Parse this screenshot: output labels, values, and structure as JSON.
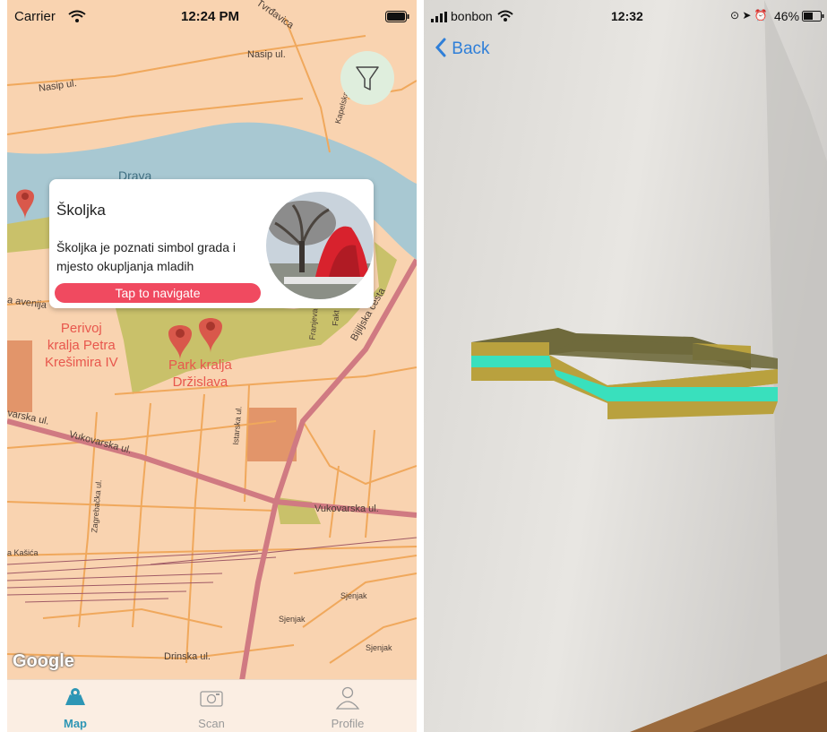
{
  "left": {
    "status": {
      "carrier": "Carrier",
      "time": "12:24 PM"
    },
    "callout": {
      "title": "Školjka",
      "description": "Školjka je poznati simbol grada i mjesto okupljanja mladih",
      "navigate": "Tap to navigate"
    },
    "map_labels": {
      "tvrdavica": "Tvrđavica",
      "nasip_top": "Nasip ul.",
      "nasip_left": "Nasip ul.",
      "kapelska": "Kapelska",
      "drava": "Drava",
      "avenija": "a avenija",
      "franjevacka": "Franjevačka",
      "fakt": "Fakt",
      "bijiljska": "Bijiljska cesta",
      "varska": "varska ul.",
      "vukovarska1": "Vukovarska ul.",
      "vukovarska2": "Vukovarska ul.",
      "istarska": "Istarska ul.",
      "zagrebacka": "Zagrebačka ul.",
      "kasica": "a Kašića",
      "sjenjak1": "Sjenjak",
      "sjenjak2": "Sjenjak",
      "sjenjak3": "Sjenjak",
      "drinska": "Drinska ul."
    },
    "parks": {
      "perivoj": "Perivoj\nkralja Petra\nKrešimira IV",
      "park_drzislava": "Park kralja\nDržislava"
    },
    "google": "Google",
    "tabs": [
      {
        "label": "Map"
      },
      {
        "label": "Scan"
      },
      {
        "label": "Profile"
      }
    ],
    "colors": {
      "accent": "#2d96b5",
      "marker": "#d9584b",
      "button": "#f04a60",
      "river": "#a8c8d2",
      "park": "#c9c16a",
      "road": "#d07a82"
    }
  },
  "right": {
    "status": {
      "carrier": "bonbon",
      "time": "12:32",
      "battery": "46%"
    },
    "back": "Back",
    "colors": {
      "layer_top": "#6f6a3c",
      "layer_side": "#b9a13e",
      "layer_stripe": "#39e0bd"
    }
  }
}
